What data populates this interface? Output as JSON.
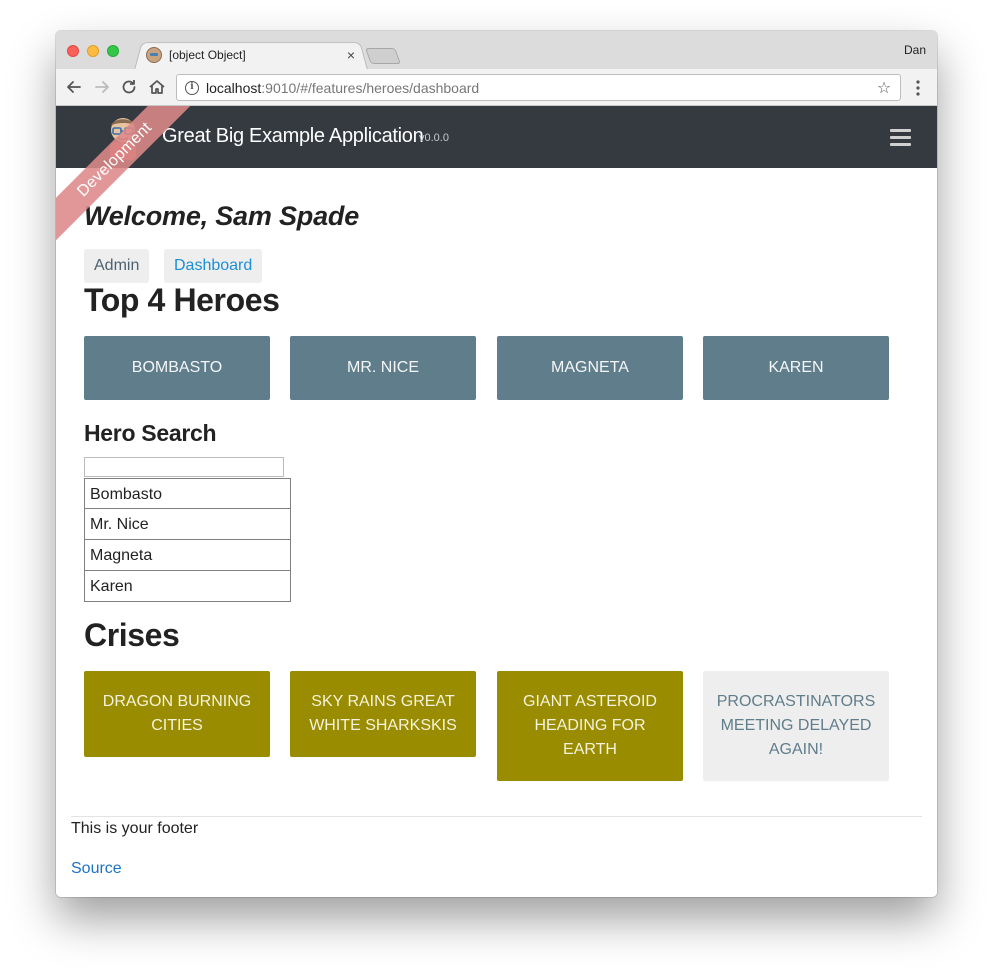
{
  "browser": {
    "tab_title": "[object Object]",
    "tab_close": "×",
    "profile_name": "Dan",
    "url_host": "localhost",
    "url_rest": ":9010/#/features/heroes/dashboard",
    "icons": {
      "back": "arrow-left-icon",
      "forward": "arrow-right-icon",
      "reload": "reload-icon",
      "home": "home-icon",
      "info": "info-icon",
      "bookmark": "star-icon",
      "menu": "more-vertical-icon"
    }
  },
  "app": {
    "brand_title": "Great Big Example Application",
    "version": "v0.0.0",
    "ribbon_label": "Development",
    "colors": {
      "navbar": "#343a40",
      "hero_card": "#607d8b",
      "crisis_card": "#9a8c00",
      "crisis_card_pending": "#eeeeee",
      "ribbon": "#dd8989",
      "link": "#1b73c9"
    }
  },
  "page": {
    "welcome": "Welcome, Sam Spade",
    "nav": [
      {
        "label": "Admin",
        "active": false
      },
      {
        "label": "Dashboard",
        "active": true
      }
    ],
    "top_heroes_title": "Top 4 Heroes",
    "top_heroes": [
      "BOMBASTO",
      "MR. NICE",
      "MAGNETA",
      "KAREN"
    ],
    "hero_search_title": "Hero Search",
    "hero_search_value": "",
    "search_results": [
      "Bombasto",
      "Mr. Nice",
      "Magneta",
      "Karen"
    ],
    "crises_title": "Crises",
    "crises": [
      "DRAGON BURNING CITIES",
      "SKY RAINS GREAT WHITE SHARKSKIS",
      "GIANT ASTEROID HEADING FOR EARTH",
      "PROCRASTINATORS MEETING DELAYED AGAIN!"
    ]
  },
  "footer": {
    "text": "This is your footer",
    "link": "Source"
  }
}
